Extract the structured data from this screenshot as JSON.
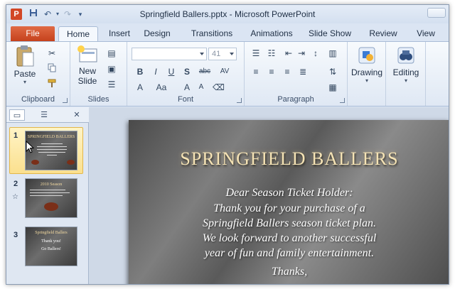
{
  "window": {
    "title": "Springfield Ballers.pptx - Microsoft PowerPoint",
    "app_icon_letter": "P",
    "accent": "#d24726"
  },
  "tabs": [
    {
      "label": "File",
      "active": false
    },
    {
      "label": "Home",
      "active": true
    },
    {
      "label": "Insert",
      "active": false
    },
    {
      "label": "Design",
      "active": false
    },
    {
      "label": "Transitions",
      "active": false
    },
    {
      "label": "Animations",
      "active": false
    },
    {
      "label": "Slide Show",
      "active": false
    },
    {
      "label": "Review",
      "active": false
    },
    {
      "label": "View",
      "active": false
    }
  ],
  "ribbon": {
    "clipboard": {
      "label": "Clipboard",
      "paste": "Paste"
    },
    "slides": {
      "label": "Slides",
      "new_slide_line1": "New",
      "new_slide_line2": "Slide"
    },
    "font": {
      "label": "Font",
      "font_name": "",
      "font_size": "41"
    },
    "paragraph": {
      "label": "Paragraph"
    },
    "drawing": {
      "label": "Drawing"
    },
    "editing": {
      "label": "Editing"
    }
  },
  "slides_pane": {
    "thumbnails": [
      {
        "number": "1",
        "title": "SPRINGFIELD BALLERS",
        "selected": true
      },
      {
        "number": "2",
        "title": "2010 Season",
        "selected": false
      },
      {
        "number": "3",
        "title": "Springfield Ballers",
        "line1": "Thank you!",
        "line2": "Go Ballers!",
        "selected": false
      }
    ]
  },
  "slide": {
    "title": "SPRINGFIELD BALLERS",
    "body": [
      "Dear Season Ticket Holder:",
      "Thank you for your purchase of a",
      "Springfield Ballers season ticket plan.",
      "We look forward to another successful",
      "year of fun and family entertainment.",
      "Thanks,"
    ]
  }
}
